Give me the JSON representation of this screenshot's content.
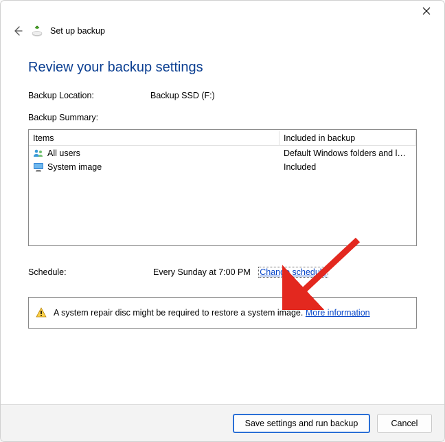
{
  "wizard_title": "Set up backup",
  "page_heading": "Review your backup settings",
  "backup_location": {
    "label": "Backup Location:",
    "value": "Backup SSD (F:)"
  },
  "summary_label": "Backup Summary:",
  "summary": {
    "headers": {
      "items": "Items",
      "included": "Included in backup"
    },
    "rows": [
      {
        "icon": "users-icon",
        "item": "All users",
        "included": "Default Windows folders and l…"
      },
      {
        "icon": "monitor-icon",
        "item": "System image",
        "included": "Included"
      }
    ]
  },
  "schedule": {
    "label": "Schedule:",
    "value": "Every Sunday at 7:00 PM",
    "change_link": "Change schedule"
  },
  "note": {
    "text": "A system repair disc might be required to restore a system image. ",
    "link": "More information"
  },
  "buttons": {
    "primary": "Save settings and run backup",
    "cancel": "Cancel"
  }
}
